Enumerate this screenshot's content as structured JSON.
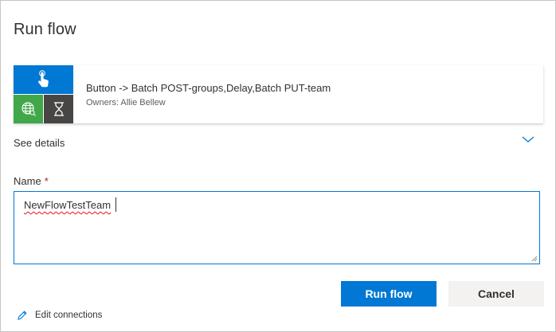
{
  "dialog": {
    "title": "Run flow"
  },
  "flow": {
    "name": "Button -> Batch POST-groups,Delay,Batch PUT-team",
    "owners": "Owners: Allie Bellew",
    "icons": [
      "touch-icon",
      "globe-icon",
      "hourglass-icon"
    ],
    "colors": {
      "trigger": "#0078d4",
      "http": "#41a84a",
      "delay": "#484644"
    }
  },
  "details": {
    "label": "See details"
  },
  "form": {
    "name_label": "Name",
    "required_marker": "*",
    "name_value": "NewFlowTestTeam"
  },
  "actions": {
    "run_label": "Run flow",
    "cancel_label": "Cancel",
    "edit_connections_label": "Edit connections"
  },
  "accent": "#0078d4"
}
